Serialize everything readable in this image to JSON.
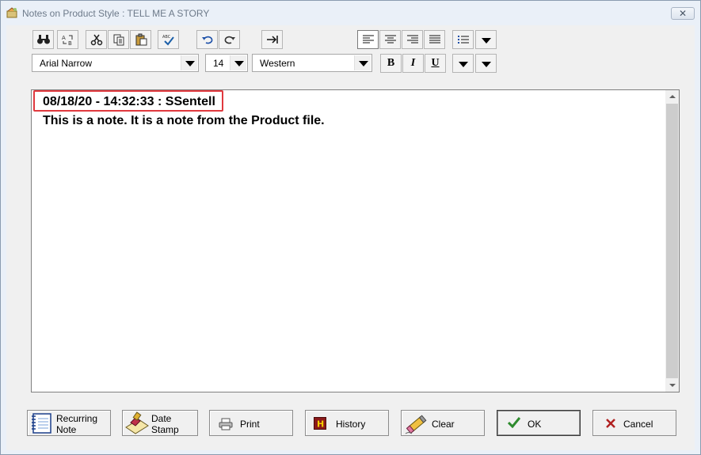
{
  "window": {
    "title": "Notes on Product Style : TELL ME A STORY",
    "close_label": "✕"
  },
  "toolbar": {
    "font_name": "Arial Narrow",
    "font_size": "14",
    "script": "Western",
    "bold_label": "B",
    "italic_label": "I",
    "underline_label": "U"
  },
  "editor": {
    "stamp_line": "08/18/20 - 14:32:33 : SSentell",
    "note_text": "This is a note.  It is a note from the Product file."
  },
  "buttons": {
    "recurring_line1": "Recurring",
    "recurring_line2": "Note",
    "date_line1": "Date",
    "date_line2": "Stamp",
    "print": "Print",
    "history": "History",
    "clear": "Clear",
    "ok": "OK",
    "cancel": "Cancel"
  },
  "colors": {
    "highlight": "#e0393e",
    "window_bg": "#f0f0f0",
    "ok_check": "#2e8b2e",
    "cancel_x": "#b02020"
  }
}
